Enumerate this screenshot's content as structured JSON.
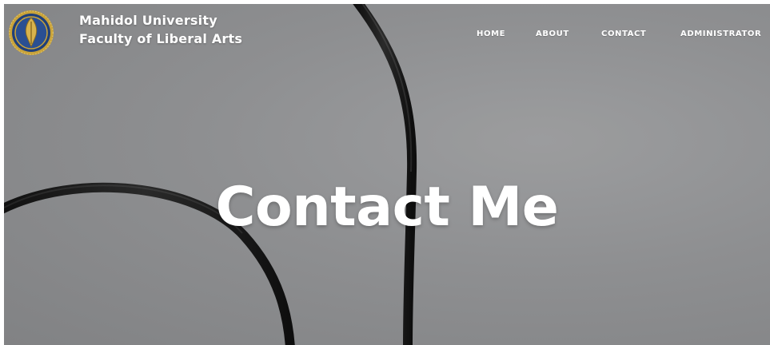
{
  "header": {
    "logo": "university-seal-logo",
    "brand_line1": "Mahidol University",
    "brand_line2": "Faculty of Liberal Arts"
  },
  "nav": {
    "items": [
      {
        "label": "HOME"
      },
      {
        "label": "ABOUT"
      },
      {
        "label": "CONTACT"
      },
      {
        "label": "ADMINISTRATOR"
      }
    ]
  },
  "hero": {
    "title": "Contact Me",
    "background": "gray photo with black cable loops"
  },
  "colors": {
    "background_gray": "#8c8d8f",
    "text": "#ffffff",
    "cable": "#1c1c1c",
    "logo_blue": "#1f3f7a",
    "logo_gold": "#c9a33a"
  }
}
